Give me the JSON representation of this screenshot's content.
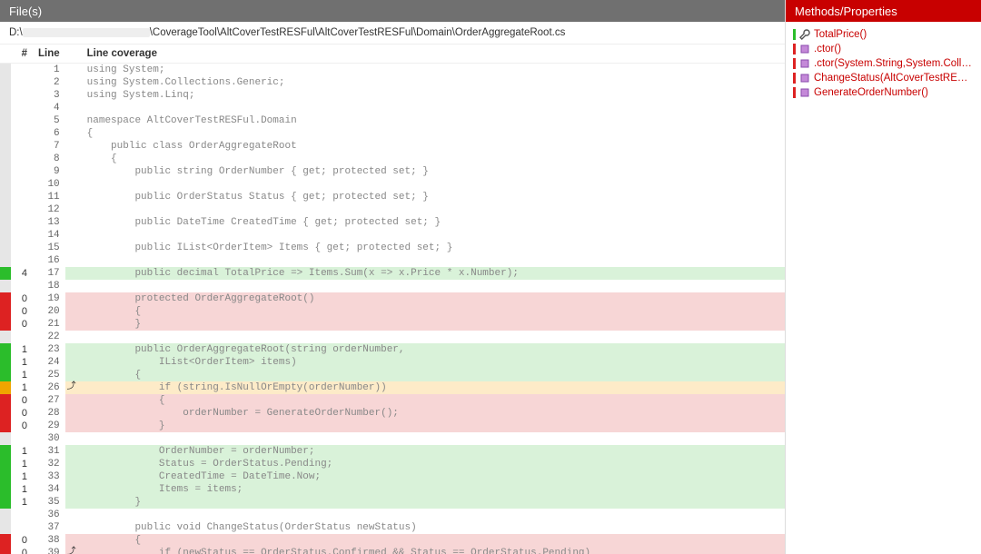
{
  "left_title": "File(s)",
  "right_title": "Methods/Properties",
  "path_prefix": "D:\\",
  "path_suffix": "\\CoverageTool\\AltCoverTestRESFul\\AltCoverTestRESFul\\Domain\\OrderAggregateRoot.cs",
  "headers": {
    "hits": "#",
    "line": "Line",
    "cov": "Line coverage"
  },
  "lines": [
    {
      "n": 1,
      "g": "none",
      "h": "",
      "b": "",
      "s": "none",
      "t": "using System;"
    },
    {
      "n": 2,
      "g": "none",
      "h": "",
      "b": "",
      "s": "none",
      "t": "using System.Collections.Generic;"
    },
    {
      "n": 3,
      "g": "none",
      "h": "",
      "b": "",
      "s": "none",
      "t": "using System.Linq;"
    },
    {
      "n": 4,
      "g": "none",
      "h": "",
      "b": "",
      "s": "none",
      "t": ""
    },
    {
      "n": 5,
      "g": "none",
      "h": "",
      "b": "",
      "s": "none",
      "t": "namespace AltCoverTestRESFul.Domain"
    },
    {
      "n": 6,
      "g": "none",
      "h": "",
      "b": "",
      "s": "none",
      "t": "{"
    },
    {
      "n": 7,
      "g": "none",
      "h": "",
      "b": "",
      "s": "none",
      "t": "    public class OrderAggregateRoot"
    },
    {
      "n": 8,
      "g": "none",
      "h": "",
      "b": "",
      "s": "none",
      "t": "    {"
    },
    {
      "n": 9,
      "g": "none",
      "h": "",
      "b": "",
      "s": "none",
      "t": "        public string OrderNumber { get; protected set; }"
    },
    {
      "n": 10,
      "g": "none",
      "h": "",
      "b": "",
      "s": "none",
      "t": ""
    },
    {
      "n": 11,
      "g": "none",
      "h": "",
      "b": "",
      "s": "none",
      "t": "        public OrderStatus Status { get; protected set; }"
    },
    {
      "n": 12,
      "g": "none",
      "h": "",
      "b": "",
      "s": "none",
      "t": ""
    },
    {
      "n": 13,
      "g": "none",
      "h": "",
      "b": "",
      "s": "none",
      "t": "        public DateTime CreatedTime { get; protected set; }"
    },
    {
      "n": 14,
      "g": "none",
      "h": "",
      "b": "",
      "s": "none",
      "t": ""
    },
    {
      "n": 15,
      "g": "none",
      "h": "",
      "b": "",
      "s": "none",
      "t": "        public IList<OrderItem> Items { get; protected set; }"
    },
    {
      "n": 16,
      "g": "none",
      "h": "",
      "b": "",
      "s": "none",
      "t": ""
    },
    {
      "n": 17,
      "g": "green",
      "h": "4",
      "b": "",
      "s": "green",
      "t": "        public decimal TotalPrice => Items.Sum(x => x.Price * x.Number);"
    },
    {
      "n": 18,
      "g": "none",
      "h": "",
      "b": "",
      "s": "none",
      "t": ""
    },
    {
      "n": 19,
      "g": "red",
      "h": "0",
      "b": "",
      "s": "red",
      "t": "        protected OrderAggregateRoot()"
    },
    {
      "n": 20,
      "g": "red",
      "h": "0",
      "b": "",
      "s": "red",
      "t": "        {"
    },
    {
      "n": 21,
      "g": "red",
      "h": "0",
      "b": "",
      "s": "red",
      "t": "        }"
    },
    {
      "n": 22,
      "g": "none",
      "h": "",
      "b": "",
      "s": "none",
      "t": ""
    },
    {
      "n": 23,
      "g": "green",
      "h": "1",
      "b": "",
      "s": "green",
      "t": "        public OrderAggregateRoot(string orderNumber,"
    },
    {
      "n": 24,
      "g": "green",
      "h": "1",
      "b": "",
      "s": "green",
      "t": "            IList<OrderItem> items)"
    },
    {
      "n": 25,
      "g": "green",
      "h": "1",
      "b": "",
      "s": "green",
      "t": "        {"
    },
    {
      "n": 26,
      "g": "amber",
      "h": "1",
      "b": "⤴",
      "s": "amber",
      "t": "            if (string.IsNullOrEmpty(orderNumber))"
    },
    {
      "n": 27,
      "g": "red",
      "h": "0",
      "b": "",
      "s": "red",
      "t": "            {"
    },
    {
      "n": 28,
      "g": "red",
      "h": "0",
      "b": "",
      "s": "red",
      "t": "                orderNumber = GenerateOrderNumber();"
    },
    {
      "n": 29,
      "g": "red",
      "h": "0",
      "b": "",
      "s": "red",
      "t": "            }"
    },
    {
      "n": 30,
      "g": "none",
      "h": "",
      "b": "",
      "s": "none",
      "t": ""
    },
    {
      "n": 31,
      "g": "green",
      "h": "1",
      "b": "",
      "s": "green",
      "t": "            OrderNumber = orderNumber;"
    },
    {
      "n": 32,
      "g": "green",
      "h": "1",
      "b": "",
      "s": "green",
      "t": "            Status = OrderStatus.Pending;"
    },
    {
      "n": 33,
      "g": "green",
      "h": "1",
      "b": "",
      "s": "green",
      "t": "            CreatedTime = DateTime.Now;"
    },
    {
      "n": 34,
      "g": "green",
      "h": "1",
      "b": "",
      "s": "green",
      "t": "            Items = items;"
    },
    {
      "n": 35,
      "g": "green",
      "h": "1",
      "b": "",
      "s": "green",
      "t": "        }"
    },
    {
      "n": 36,
      "g": "none",
      "h": "",
      "b": "",
      "s": "none",
      "t": ""
    },
    {
      "n": 37,
      "g": "none",
      "h": "",
      "b": "",
      "s": "none",
      "t": "        public void ChangeStatus(OrderStatus newStatus)"
    },
    {
      "n": 38,
      "g": "red",
      "h": "0",
      "b": "",
      "s": "red",
      "t": "        {"
    },
    {
      "n": 39,
      "g": "red",
      "h": "0",
      "b": "⤴",
      "s": "red",
      "t": "            if (newStatus == OrderStatus.Confirmed && Status == OrderStatus.Pending)"
    }
  ],
  "methods": [
    {
      "bar": "g",
      "icon": "wrench",
      "label": "TotalPrice()"
    },
    {
      "bar": "r",
      "icon": "method",
      "label": ".ctor()"
    },
    {
      "bar": "r",
      "icon": "method",
      "label": ".ctor(System.String,System.Collections.G…"
    },
    {
      "bar": "r",
      "icon": "method",
      "label": "ChangeStatus(AltCoverTestRESFul.Dom…"
    },
    {
      "bar": "r",
      "icon": "method",
      "label": "GenerateOrderNumber()"
    }
  ]
}
